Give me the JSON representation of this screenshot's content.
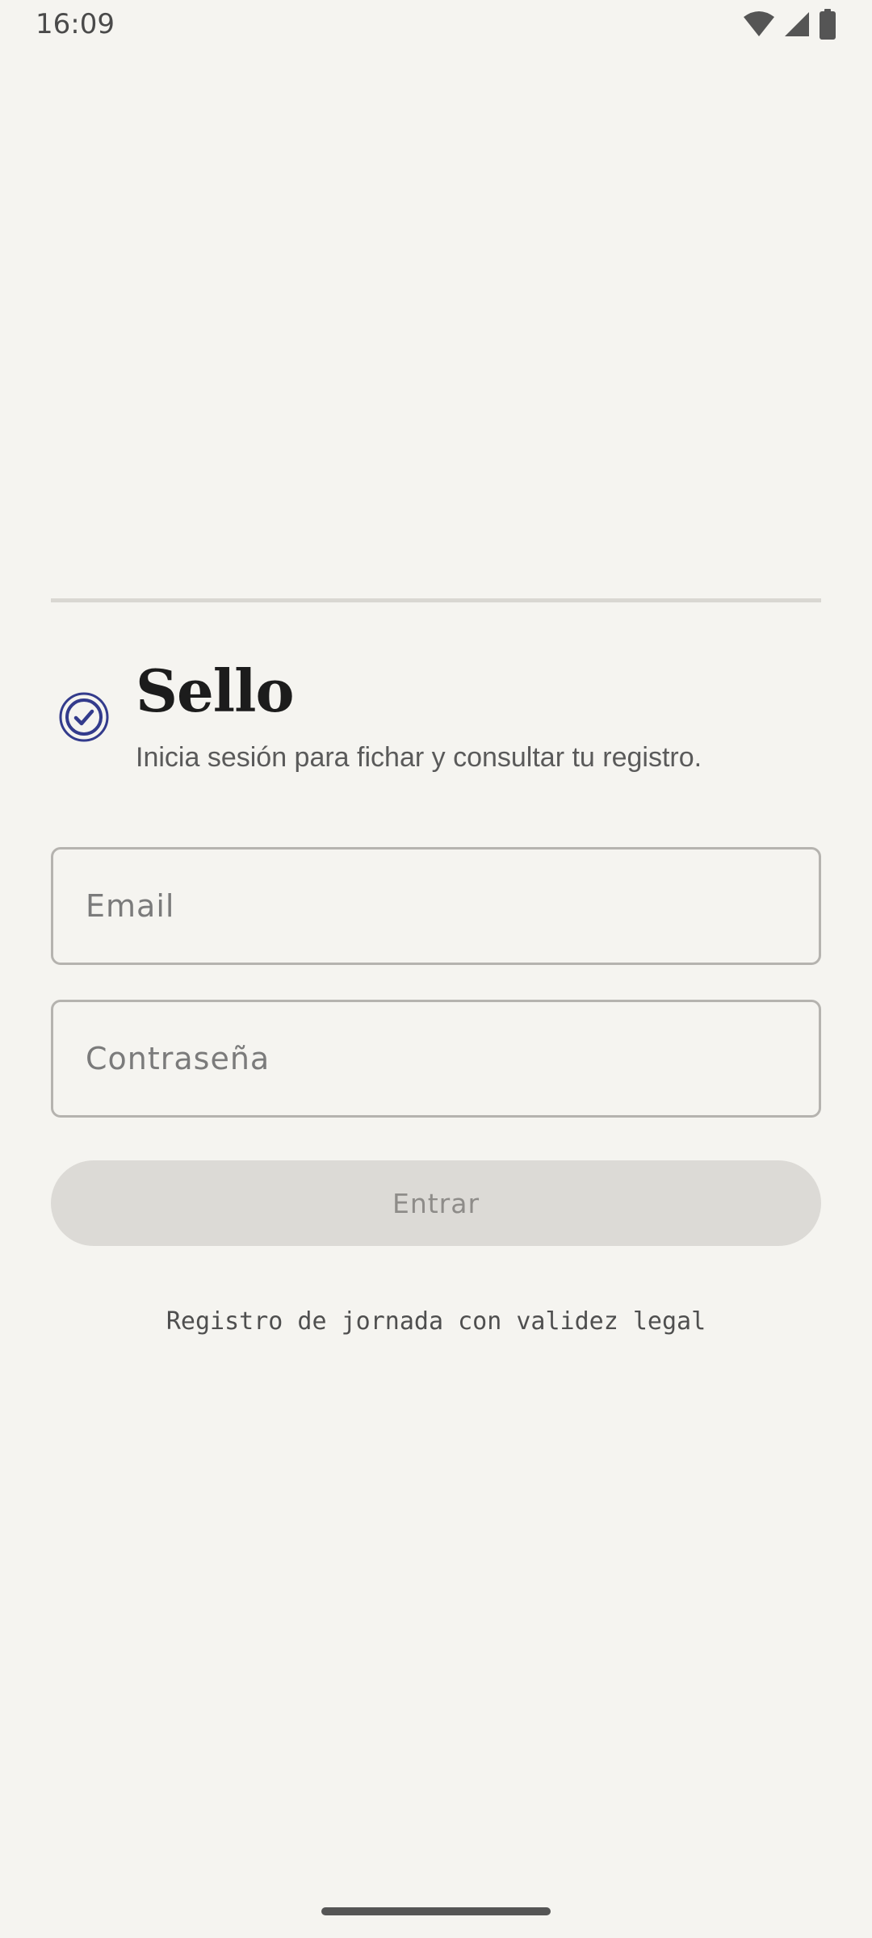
{
  "status_bar": {
    "time": "16:09",
    "icons": [
      "wifi-icon",
      "signal-icon",
      "battery-icon"
    ]
  },
  "brand": {
    "icon": "check-circle-icon",
    "title": "Sello",
    "subtitle": "Inicia sesión para fichar y consultar tu registro."
  },
  "form": {
    "email_placeholder": "Email",
    "email_value": "",
    "password_placeholder": "Contraseña",
    "password_value": "",
    "submit_label": "Entrar",
    "submit_enabled": false
  },
  "footer": {
    "note": "Registro de jornada con validez legal"
  },
  "colors": {
    "background": "#F5F4F0",
    "accent": "#333B8C",
    "disabled_button": "#DCDAD6",
    "disabled_text": "#8E8C89"
  }
}
